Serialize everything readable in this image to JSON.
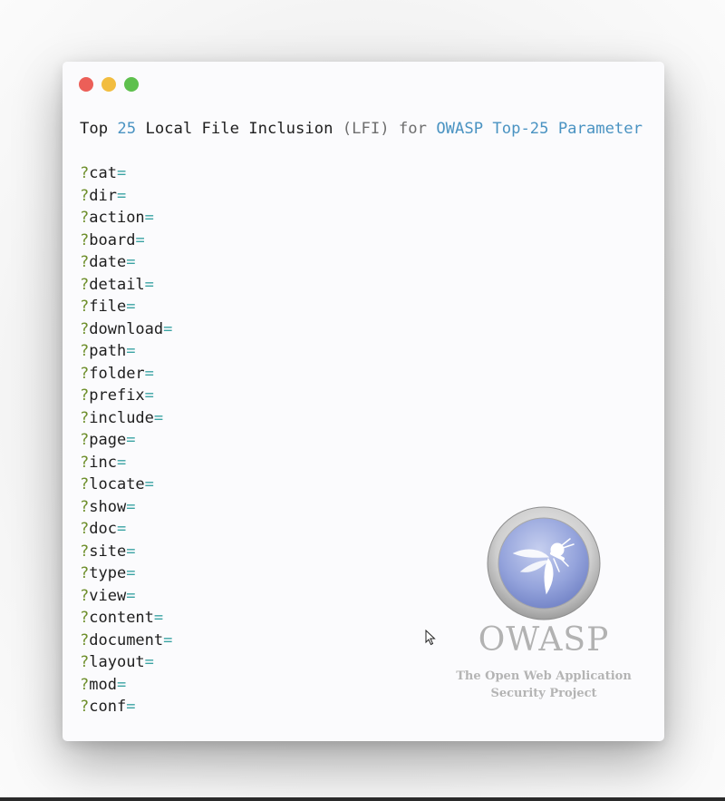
{
  "window": {
    "controls": [
      {
        "name": "close",
        "color": "#ec5f58"
      },
      {
        "name": "minimize",
        "color": "#f2bd3f"
      },
      {
        "name": "maximize",
        "color": "#5ec04d"
      }
    ]
  },
  "heading": {
    "parts": [
      {
        "text": "Top",
        "color": "#1e1e1e"
      },
      {
        "text": " ",
        "color": "#1e1e1e"
      },
      {
        "text": "25",
        "color": "#4a93c2"
      },
      {
        "text": " ",
        "color": "#1e1e1e"
      },
      {
        "text": "Local File Inclusion",
        "color": "#1e1e1e"
      },
      {
        "text": " ",
        "color": "#1e1e1e"
      },
      {
        "text": "(LFI)",
        "color": "#6e6e6e"
      },
      {
        "text": " ",
        "color": "#1e1e1e"
      },
      {
        "text": "for",
        "color": "#6e6e6e"
      },
      {
        "text": " ",
        "color": "#1e1e1e"
      },
      {
        "text": "OWASP Top-25 Parameter",
        "color": "#4a93c2"
      }
    ]
  },
  "syntax_colors": {
    "question_mark": "#6d8e2a",
    "name": "#1e1e1e",
    "equals": "#3aa3a3"
  },
  "parameters": [
    {
      "q": "?",
      "name": "cat",
      "eq": "="
    },
    {
      "q": "?",
      "name": "dir",
      "eq": "="
    },
    {
      "q": "?",
      "name": "action",
      "eq": "="
    },
    {
      "q": "?",
      "name": "board",
      "eq": "="
    },
    {
      "q": "?",
      "name": "date",
      "eq": "="
    },
    {
      "q": "?",
      "name": "detail",
      "eq": "="
    },
    {
      "q": "?",
      "name": "file",
      "eq": "="
    },
    {
      "q": "?",
      "name": "download",
      "eq": "="
    },
    {
      "q": "?",
      "name": "path",
      "eq": "="
    },
    {
      "q": "?",
      "name": "folder",
      "eq": "="
    },
    {
      "q": "?",
      "name": "prefix",
      "eq": "="
    },
    {
      "q": "?",
      "name": "include",
      "eq": "="
    },
    {
      "q": "?",
      "name": "page",
      "eq": "="
    },
    {
      "q": "?",
      "name": "inc",
      "eq": "="
    },
    {
      "q": "?",
      "name": "locate",
      "eq": "="
    },
    {
      "q": "?",
      "name": "show",
      "eq": "="
    },
    {
      "q": "?",
      "name": "doc",
      "eq": "="
    },
    {
      "q": "?",
      "name": "site",
      "eq": "="
    },
    {
      "q": "?",
      "name": "type",
      "eq": "="
    },
    {
      "q": "?",
      "name": "view",
      "eq": "="
    },
    {
      "q": "?",
      "name": "content",
      "eq": "="
    },
    {
      "q": "?",
      "name": "document",
      "eq": "="
    },
    {
      "q": "?",
      "name": "layout",
      "eq": "="
    },
    {
      "q": "?",
      "name": "mod",
      "eq": "="
    },
    {
      "q": "?",
      "name": "conf",
      "eq": "="
    }
  ],
  "owasp": {
    "logo_icon": "owasp-wasp-logo",
    "name": "OWASP",
    "tagline_line1": "The Open Web Application",
    "tagline_line2": "Security Project"
  },
  "cursor_icon": "mouse-pointer-icon"
}
